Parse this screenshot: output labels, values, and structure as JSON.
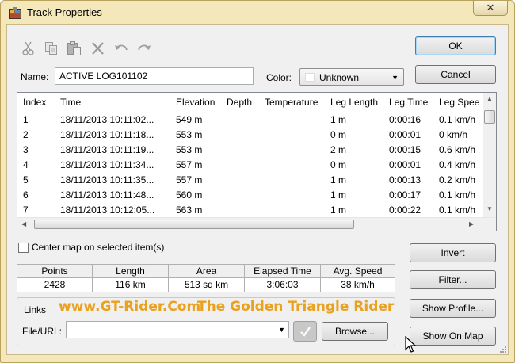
{
  "window": {
    "title": "Track Properties",
    "close_label": "✕"
  },
  "toolbar": {
    "icons": [
      "cut-icon",
      "copy-icon",
      "paste-icon",
      "delete-icon",
      "undo-icon",
      "redo-icon"
    ]
  },
  "form": {
    "name_label": "Name:",
    "name_value": "ACTIVE LOG101102",
    "color_label": "Color:",
    "color_value": "Unknown"
  },
  "buttons": {
    "ok": "OK",
    "cancel": "Cancel",
    "invert": "Invert",
    "filter": "Filter...",
    "show_profile": "Show Profile...",
    "show_on_map": "Show On Map",
    "browse": "Browse..."
  },
  "table": {
    "columns": [
      "Index",
      "Time",
      "Elevation",
      "Depth",
      "Temperature",
      "Leg Length",
      "Leg Time",
      "Leg Spee"
    ],
    "rows": [
      [
        "1",
        "18/11/2013 10:11:02...",
        "549 m",
        "",
        "",
        "1 m",
        "0:00:16",
        "0.1 km/h"
      ],
      [
        "2",
        "18/11/2013 10:11:18...",
        "553 m",
        "",
        "",
        "0 m",
        "0:00:01",
        "0 km/h"
      ],
      [
        "3",
        "18/11/2013 10:11:19...",
        "553 m",
        "",
        "",
        "2 m",
        "0:00:15",
        "0.6 km/h"
      ],
      [
        "4",
        "18/11/2013 10:11:34...",
        "557 m",
        "",
        "",
        "0 m",
        "0:00:01",
        "0.4 km/h"
      ],
      [
        "5",
        "18/11/2013 10:11:35...",
        "557 m",
        "",
        "",
        "1 m",
        "0:00:13",
        "0.2 km/h"
      ],
      [
        "6",
        "18/11/2013 10:11:48...",
        "560 m",
        "",
        "",
        "1 m",
        "0:00:17",
        "0.1 km/h"
      ],
      [
        "7",
        "18/11/2013 10:12:05...",
        "563 m",
        "",
        "",
        "1 m",
        "0:00:22",
        "0.1 km/h"
      ]
    ]
  },
  "center_map": {
    "label": "Center map on selected item(s)",
    "checked": false
  },
  "stats": [
    {
      "label": "Points",
      "value": "2428"
    },
    {
      "label": "Length",
      "value": "116 km"
    },
    {
      "label": "Area",
      "value": "513 sq km"
    },
    {
      "label": "Elapsed Time",
      "value": "3:06:03"
    },
    {
      "label": "Avg. Speed",
      "value": "38 km/h"
    }
  ],
  "links": {
    "group_label": "Links",
    "file_label": "File/URL:",
    "file_value": ""
  },
  "watermark": {
    "site": "www.GT-Rider.Com",
    "tagline": "The Golden Triangle Rider"
  },
  "colors": {
    "titlebar": "#f4e7ba",
    "client": "#f0f0f0",
    "watermark": "#e9a11e"
  }
}
